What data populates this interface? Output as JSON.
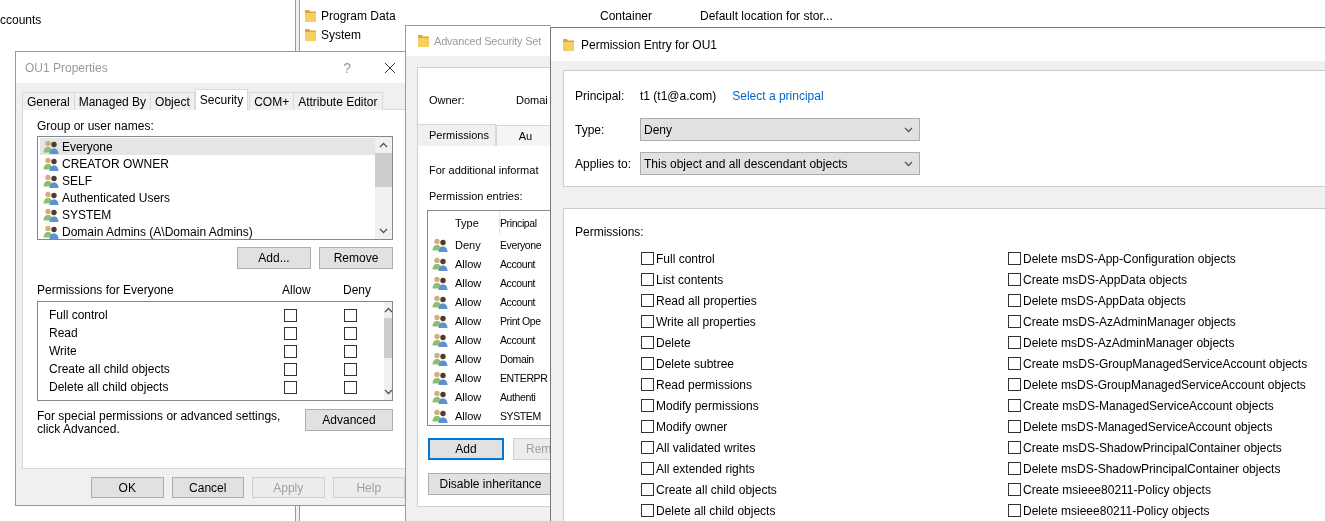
{
  "background_window": {
    "tree_item": "ccounts",
    "rows": [
      {
        "name": "Program Data",
        "type": "Container",
        "description": "Default location for stor..."
      },
      {
        "name": "System"
      }
    ]
  },
  "properties_dialog": {
    "title": "OU1 Properties",
    "help": "?",
    "tabs": [
      {
        "label": "General",
        "selected": false
      },
      {
        "label": "Managed By",
        "selected": false
      },
      {
        "label": "Object",
        "selected": false
      },
      {
        "label": "Security",
        "selected": true
      },
      {
        "label": "COM+",
        "selected": false
      },
      {
        "label": "Attribute Editor",
        "selected": false
      }
    ],
    "groups_label": "Group or user names:",
    "groups": [
      {
        "name": "Everyone",
        "selected": true
      },
      {
        "name": "CREATOR OWNER",
        "selected": false
      },
      {
        "name": "SELF",
        "selected": false
      },
      {
        "name": "Authenticated Users",
        "selected": false
      },
      {
        "name": "SYSTEM",
        "selected": false
      },
      {
        "name": "Domain Admins (A\\Domain Admins)",
        "selected": false
      }
    ],
    "group_buttons": [
      "Add...",
      "Remove"
    ],
    "permissions_label": "Permissions for Everyone",
    "allow_label": "Allow",
    "deny_label": "Deny",
    "permissions": [
      {
        "name": "Full control",
        "allow": false,
        "deny": false
      },
      {
        "name": "Read",
        "allow": false,
        "deny": false
      },
      {
        "name": "Write",
        "allow": false,
        "deny": false
      },
      {
        "name": "Create all child objects",
        "allow": false,
        "deny": false
      },
      {
        "name": "Delete all child objects",
        "allow": false,
        "deny": false
      }
    ],
    "advanced_note": "For special permissions or advanced settings, click Advanced.",
    "advanced_button": "Advanced",
    "buttons": [
      {
        "label": "OK",
        "disabled": false
      },
      {
        "label": "Cancel",
        "disabled": false
      },
      {
        "label": "Apply",
        "disabled": true
      },
      {
        "label": "Help",
        "disabled": true
      }
    ]
  },
  "advanced_dialog": {
    "title": "Advanced Security Set",
    "owner_label": "Owner:",
    "owner": "Domai",
    "tabs": [
      {
        "label": "Permissions",
        "selected": true
      },
      {
        "label": "Au",
        "selected": false
      }
    ],
    "info": "For additional informat",
    "entries_label": "Permission entries:",
    "columns": [
      "Type",
      "Principal"
    ],
    "entries": [
      {
        "type": "Deny",
        "principal": "Everyone"
      },
      {
        "type": "Allow",
        "principal": "Account"
      },
      {
        "type": "Allow",
        "principal": "Account"
      },
      {
        "type": "Allow",
        "principal": "Account"
      },
      {
        "type": "Allow",
        "principal": "Print Ope"
      },
      {
        "type": "Allow",
        "principal": "Account"
      },
      {
        "type": "Allow",
        "principal": "Domain"
      },
      {
        "type": "Allow",
        "principal": "ENTERPR"
      },
      {
        "type": "Allow",
        "principal": "Authenti"
      },
      {
        "type": "Allow",
        "principal": "SYSTEM"
      }
    ],
    "buttons": [
      {
        "label": "Add",
        "default": true,
        "disabled": false
      },
      {
        "label": "Rem",
        "default": false,
        "disabled": true
      }
    ],
    "inheritance_button": "Disable inheritance"
  },
  "entry_dialog": {
    "title": "Permission Entry for OU1",
    "principal_label": "Principal:",
    "principal": "t1 (t1@a.com)",
    "principal_link": "Select a principal",
    "type_label": "Type:",
    "type": "Deny",
    "applies_label": "Applies to:",
    "applies_to": "This object and all descendant objects",
    "permissions_label": "Permissions:",
    "permissions": [
      {
        "label": "Full control",
        "checked": false
      },
      {
        "label": "List contents",
        "checked": false
      },
      {
        "label": "Read all properties",
        "checked": false
      },
      {
        "label": "Write all properties",
        "checked": false
      },
      {
        "label": "Delete",
        "checked": false
      },
      {
        "label": "Delete subtree",
        "checked": false
      },
      {
        "label": "Read permissions",
        "checked": false
      },
      {
        "label": "Modify permissions",
        "checked": false
      },
      {
        "label": "Modify owner",
        "checked": false
      },
      {
        "label": "All validated writes",
        "checked": false
      },
      {
        "label": "All extended rights",
        "checked": false
      },
      {
        "label": "Create all child objects",
        "checked": false
      },
      {
        "label": "Delete all child objects",
        "checked": false
      },
      {
        "label": "Delete msDS-App-Configuration objects",
        "checked": false
      },
      {
        "label": "Create msDS-AppData objects",
        "checked": false
      },
      {
        "label": "Delete msDS-AppData objects",
        "checked": false
      },
      {
        "label": "Create msDS-AzAdminManager objects",
        "checked": false
      },
      {
        "label": "Delete msDS-AzAdminManager objects",
        "checked": false
      },
      {
        "label": "Create msDS-GroupManagedServiceAccount objects",
        "checked": false
      },
      {
        "label": "Delete msDS-GroupManagedServiceAccount objects",
        "checked": false
      },
      {
        "label": "Create msDS-ManagedServiceAccount objects",
        "checked": false
      },
      {
        "label": "Delete msDS-ManagedServiceAccount objects",
        "checked": false
      },
      {
        "label": "Create msDS-ShadowPrincipalContainer objects",
        "checked": false
      },
      {
        "label": "Delete msDS-ShadowPrincipalContainer objects",
        "checked": false
      },
      {
        "label": "Create msieee80211-Policy objects",
        "checked": false
      },
      {
        "label": "Delete msieee80211-Policy objects",
        "checked": false
      }
    ]
  }
}
